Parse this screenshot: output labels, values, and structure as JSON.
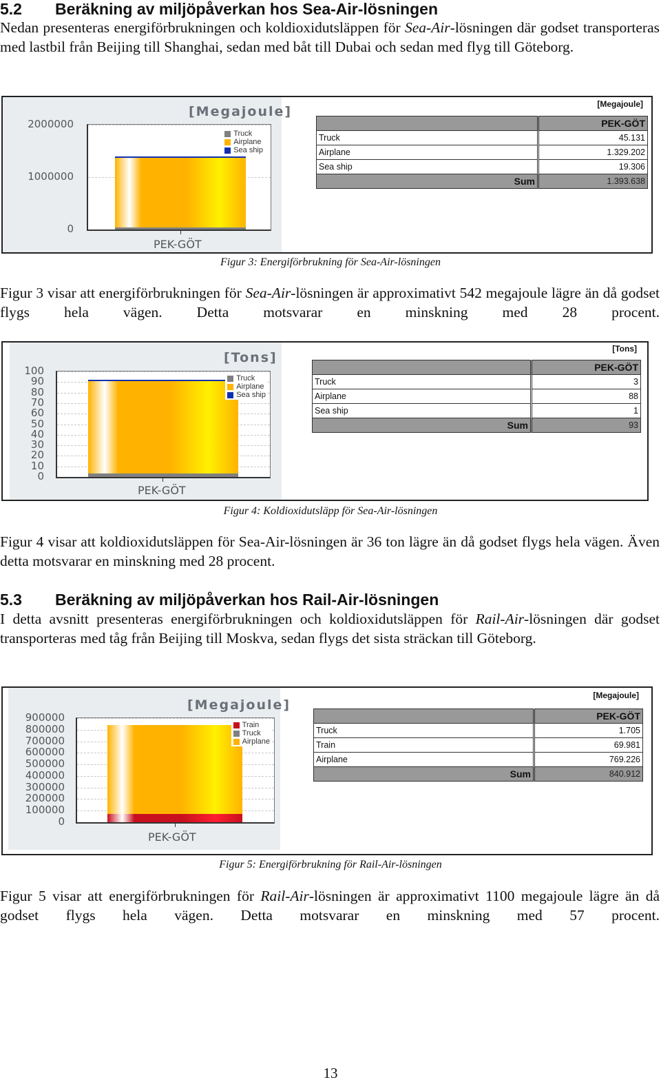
{
  "section_52": {
    "number": "5.2",
    "title": "Beräkning av miljöpåverkan hos Sea-Air-lösningen",
    "intro": {
      "before": "Nedan presenteras energiförbrukningen och koldioxidutsläppen för ",
      "italic": "Sea-Air",
      "after": "-lösningen där godset transporteras med lastbil från Beijing till Shanghai, sedan med båt till Dubai och sedan med flyg till Göteborg."
    }
  },
  "figure3": {
    "caption": "Figur 3: Energiförbrukning för Sea-Air-lösningen",
    "text": {
      "before": "Figur 3 visar att energiförbrukningen för ",
      "italic": "Sea-Air",
      "after": "-lösningen är approximativt 542 megajoule lägre än då godset flygs hela vägen. Detta motsvarar en minskning med 28 procent."
    },
    "table": {
      "unit": "[Megajoule]",
      "column": "PEK-GÖT",
      "rows": [
        {
          "label": "Truck",
          "value": "45.131"
        },
        {
          "label": "Airplane",
          "value": "1.329.202"
        },
        {
          "label": "Sea ship",
          "value": "19.306"
        }
      ],
      "sum_label": "Sum",
      "sum_value": "1.393.638"
    }
  },
  "figure4": {
    "caption": "Figur 4: Koldioxidutsläpp för Sea-Air-lösningen",
    "text": "Figur 4 visar att koldioxidutsläppen för Sea-Air-lösningen är 36 ton lägre än då godset flygs hela vägen. Även detta motsvarar en minskning med 28 procent.",
    "table": {
      "unit": "[Tons]",
      "column": "PEK-GÖT",
      "rows": [
        {
          "label": "Truck",
          "value": "3"
        },
        {
          "label": "Airplane",
          "value": "88"
        },
        {
          "label": "Sea ship",
          "value": "1"
        }
      ],
      "sum_label": "Sum",
      "sum_value": "93"
    }
  },
  "section_53": {
    "number": "5.3",
    "title": "Beräkning av miljöpåverkan hos Rail-Air-lösningen",
    "intro": {
      "before": "I detta avsnitt presenteras energiförbrukningen och koldioxidutsläppen för ",
      "italic": "Rail-Air",
      "after": "-lösningen där godset transporteras med tåg från Beijing till Moskva, sedan flygs det sista sträckan till Göteborg."
    }
  },
  "figure5": {
    "caption": "Figur 5: Energiförbrukning för Rail-Air-lösningen",
    "text": {
      "before": "Figur 5 visar att energiförbrukningen för ",
      "italic": "Rail-Air",
      "after": "-lösningen är approximativt 1100 megajoule lägre än då godset flygs hela vägen. Detta motsvarar en minskning med 57 procent."
    },
    "table": {
      "unit": "[Megajoule]",
      "column": "PEK-GÖT",
      "rows": [
        {
          "label": "Truck",
          "value": "1.705"
        },
        {
          "label": "Train",
          "value": "69.981"
        },
        {
          "label": "Airplane",
          "value": "769.226"
        }
      ],
      "sum_label": "Sum",
      "sum_value": "840.912"
    }
  },
  "page_number": "13",
  "colors": {
    "truck": "#808080",
    "airplane": "#ffb300",
    "sea_ship": "#1030b0",
    "train": "#c8101e"
  },
  "chart_data": [
    {
      "type": "bar",
      "stacked": true,
      "title": "[Megajoule]",
      "categories": [
        "PEK-GÖT"
      ],
      "series": [
        {
          "name": "Truck",
          "values": [
            45131
          ],
          "color": "#808080"
        },
        {
          "name": "Airplane",
          "values": [
            1329202
          ],
          "color": "#ffb300"
        },
        {
          "name": "Sea ship",
          "values": [
            19306
          ],
          "color": "#1030b0"
        }
      ],
      "yticks": [
        "0",
        "1000000",
        "2000000"
      ],
      "ytick_values": [
        0,
        1000000,
        2000000
      ],
      "ylim": [
        0,
        2000000
      ],
      "xlabel": "",
      "ylabel": "",
      "grid": true,
      "legend": "top-right"
    },
    {
      "type": "bar",
      "stacked": true,
      "title": "[Tons]",
      "categories": [
        "PEK-GÖT"
      ],
      "series": [
        {
          "name": "Truck",
          "values": [
            3
          ],
          "color": "#808080"
        },
        {
          "name": "Airplane",
          "values": [
            88
          ],
          "color": "#ffb300"
        },
        {
          "name": "Sea ship",
          "values": [
            1
          ],
          "color": "#1030b0"
        }
      ],
      "yticks": [
        "0",
        "10",
        "20",
        "30",
        "40",
        "50",
        "60",
        "70",
        "80",
        "90",
        "100"
      ],
      "ytick_values": [
        0,
        10,
        20,
        30,
        40,
        50,
        60,
        70,
        80,
        90,
        100
      ],
      "ylim": [
        0,
        100
      ],
      "xlabel": "",
      "ylabel": "",
      "grid": true,
      "legend": "top-right"
    },
    {
      "type": "bar",
      "stacked": true,
      "title": "[Megajoule]",
      "categories": [
        "PEK-GÖT"
      ],
      "series": [
        {
          "name": "Train",
          "values": [
            69981
          ],
          "color": "#c8101e"
        },
        {
          "name": "Truck",
          "values": [
            1705
          ],
          "color": "#808080"
        },
        {
          "name": "Airplane",
          "values": [
            769226
          ],
          "color": "#ffb300"
        }
      ],
      "yticks": [
        "0",
        "100000",
        "200000",
        "300000",
        "400000",
        "500000",
        "600000",
        "700000",
        "800000",
        "900000"
      ],
      "ytick_values": [
        0,
        100000,
        200000,
        300000,
        400000,
        500000,
        600000,
        700000,
        800000,
        900000
      ],
      "ylim": [
        0,
        900000
      ],
      "xlabel": "",
      "ylabel": "",
      "grid": true,
      "legend": "top-right"
    }
  ]
}
